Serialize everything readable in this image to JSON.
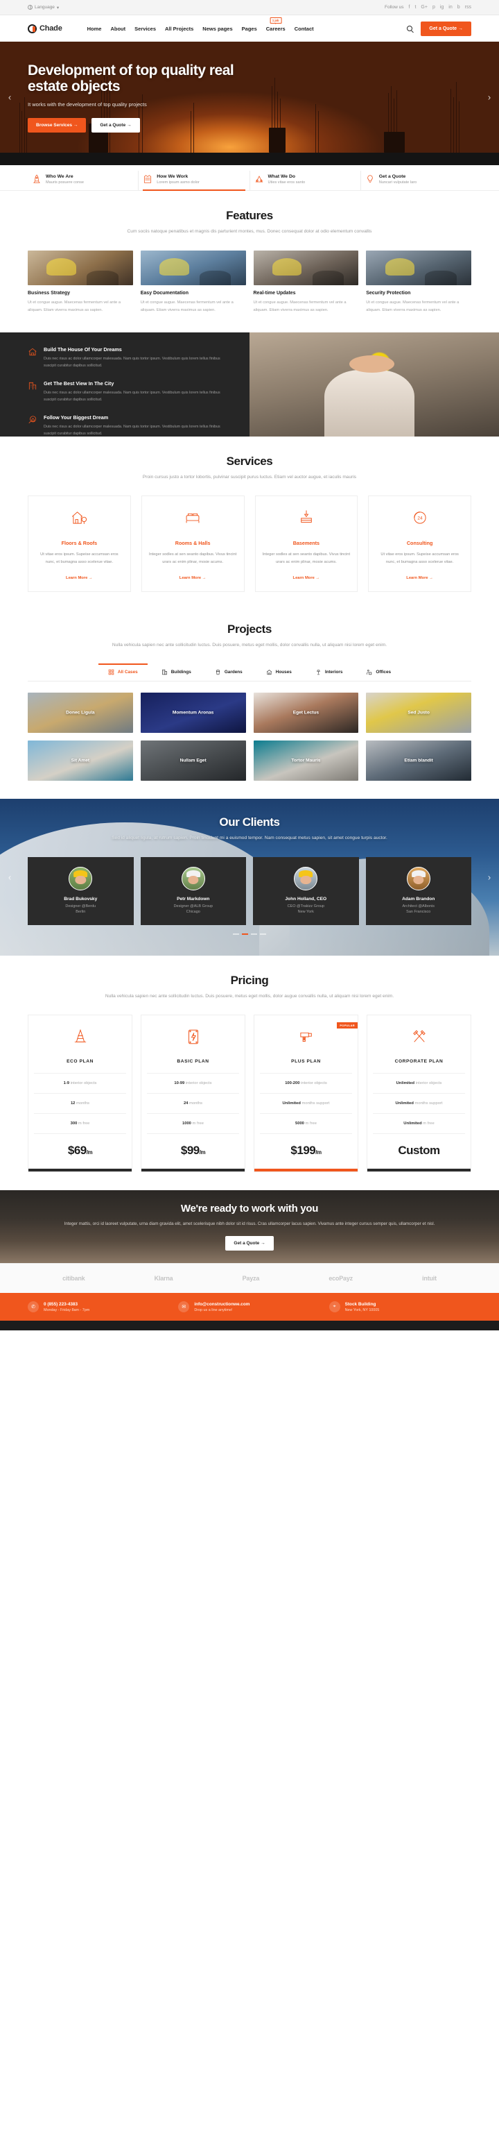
{
  "topbar": {
    "language_label": "Language",
    "language_caret": "▾",
    "follow_label": "Follow us",
    "socials": [
      "f",
      "t",
      "G+",
      "p",
      "ig",
      "in",
      "b",
      "rss"
    ]
  },
  "header": {
    "logo_text": "Chade",
    "nav": [
      {
        "label": "Home"
      },
      {
        "label": "About"
      },
      {
        "label": "Services"
      },
      {
        "label": "All Projects"
      },
      {
        "label": "News pages"
      },
      {
        "label": "Pages"
      },
      {
        "label": "Careers",
        "badge": "1 job"
      },
      {
        "label": "Contact"
      }
    ],
    "quote_button": "Get a Quote  →"
  },
  "hero": {
    "title": "Development of top quality real estate objects",
    "subtitle": "It works with the development of top quality projects",
    "btn_primary": "Browse Services  →",
    "btn_secondary": "Get a Quote  →",
    "prev": "‹",
    "next": "›"
  },
  "quickbar": [
    {
      "title": "Who We Are",
      "sub": "Mauris posuere conse",
      "icon": "rocket-icon"
    },
    {
      "title": "How We Work",
      "sub": "Lorem ipsum asmo dolor",
      "icon": "vest-icon"
    },
    {
      "title": "What We Do",
      "sub": "Uties vitae eros santo",
      "icon": "crane-icon"
    },
    {
      "title": "Get a Quote",
      "sub": "Nuncari vulputate laro",
      "icon": "bulb-icon"
    }
  ],
  "features": {
    "title": "Features",
    "subtitle": "Cum sociis natoque penatibus et magnis dis parturient montes, mus. Donec consequat dolor at odio elementum convallis",
    "items": [
      {
        "title": "Business Strategy",
        "desc": "Ut et congue augue. Maecenas fermentum vel ante a aliquam. Etiam viverra maximus as sapien."
      },
      {
        "title": "Easy Documentation",
        "desc": "Ut et congue augue. Maecenas fermentum vel ante a aliquam. Etiam viverra maximus as sapien."
      },
      {
        "title": "Real-time Updates",
        "desc": "Ut et congue augue. Maecenas fermentum vel ante a aliquam. Etiam viverra maximus as sapien."
      },
      {
        "title": "Security Protection",
        "desc": "Ut et congue augue. Maecenas fermentum vel ante a aliquam. Etiam viverra maximus as sapien."
      }
    ]
  },
  "split": {
    "items": [
      {
        "title": "Build The House Of Your Dreams",
        "desc": "Duis nec risus ac dolor ullamcorper malesuada. Nam quis tortor ipsum. Vestibulum quis lorem tellus finibus suscipit curabitur dapibus sollicitud.",
        "icon": "house-icon"
      },
      {
        "title": "Get The Best View In The City",
        "desc": "Duis nec risus ac dolor ullamcorper malesuada. Nam quis tortor ipsum. Vestibulum quis lorem tellus finibus suscipit curabitur dapibus sollicitud.",
        "icon": "building-icon"
      },
      {
        "title": "Follow Your Biggest Dream",
        "desc": "Duis nec risus ac dolor ullamcorper malesuada. Nam quis tortor ipsum. Vestibulum quis lorem tellus finibus suscipit curabitur dapibus sollicitud.",
        "icon": "search-house-icon"
      }
    ]
  },
  "services": {
    "title": "Services",
    "subtitle": "Proin cursus justo a tortor lobortis, pulvinar suscipit purus luctus. Etiam vel auctor augue, et iaculis mauris",
    "cards": [
      {
        "title": "Floors & Roofs",
        "desc": "Ut vitae eros ipsum. Supeise accumsan eros nunc, et bumagna asso scelerue vitae.",
        "more": "Learn More  →",
        "icon": "house-tree-icon"
      },
      {
        "title": "Rooms & Halls",
        "desc": "Integer sodles at sen seanto dapibus. Vivus tincint urars ac enim plinar, mosie acums.",
        "more": "Learn More  →",
        "icon": "bed-icon"
      },
      {
        "title": "Basements",
        "desc": "Integer sodles at sen seanto dapibus. Vivus tincint urars ac enim plinar, mosie acums.",
        "more": "Learn More  →",
        "icon": "crane-hook-icon"
      },
      {
        "title": "Consulting",
        "desc": "Ut vitae eros ipsum. Supeise accumsan eros nunc, et bumagna asso scelerue vitae.",
        "more": "Learn More  →",
        "icon": "24-support-icon"
      }
    ]
  },
  "projects": {
    "title": "Projects",
    "subtitle": "Nulla vehicula sapien nec ante sollicitudin luctus. Duis posuere, metus eget mollis, dolor convallis nulla, ut aliquam nisi lorem eget enim.",
    "filters": [
      {
        "label": "All Cases",
        "icon": "grid-icon",
        "active": true
      },
      {
        "label": "Buildings",
        "icon": "buildings-icon",
        "active": false
      },
      {
        "label": "Gardens",
        "icon": "plant-icon",
        "active": false
      },
      {
        "label": "Houses",
        "icon": "house-icon",
        "active": false
      },
      {
        "label": "Interiors",
        "icon": "lamp-icon",
        "active": false
      },
      {
        "label": "Offices",
        "icon": "desk-icon",
        "active": false
      }
    ],
    "cards": [
      {
        "label": "Donec Ligula"
      },
      {
        "label": "Momentum Aronas"
      },
      {
        "label": "Eget Lectus"
      },
      {
        "label": "Sed Justo"
      },
      {
        "label": "Sit Amet"
      },
      {
        "label": "Nullam Eget"
      },
      {
        "label": "Tortor Mauris"
      },
      {
        "label": "Etiam blandit"
      }
    ]
  },
  "clients": {
    "title": "Our Clients",
    "subtitle": "Sed id aliquet ligula, at rutrum sapien. Proin tincidunt mi a euismod tempor. Nam consequat metus sapien, sit amet congue turpis auctor.",
    "prev": "‹",
    "next": "›",
    "cards": [
      {
        "name": "Brad Bukovsky",
        "role": "Designer @Berdu",
        "city": "Berlin"
      },
      {
        "name": "Petr Markdown",
        "role": "Designer @ALB Group",
        "city": "Chicago"
      },
      {
        "name": "John Holland, CEO",
        "role": "CEO @Trakizz Group",
        "city": "New York"
      },
      {
        "name": "Adam Brandon",
        "role": "Architect @Albonis",
        "city": "San Francisco"
      }
    ]
  },
  "pricing": {
    "title": "Pricing",
    "subtitle": "Nulla vehicula sapien nec ante sollicitudin luctus. Duis posuere, metus eget mollis, dolor augue convallis nulla, ut aliquam nisi lorem eget enim.",
    "popular_badge": "POPULAR",
    "plans": [
      {
        "name": "ECO PLAN",
        "icon": "cone-icon",
        "rows": [
          {
            "strong": "1-9",
            "rest": " interior objects"
          },
          {
            "strong": "12",
            "rest": " months"
          },
          {
            "strong": "300",
            "rest": " m free"
          }
        ],
        "amount": "$69",
        "per": "/m",
        "accent": false
      },
      {
        "name": "BASIC PLAN",
        "icon": "battery-icon",
        "rows": [
          {
            "strong": "10-99",
            "rest": " interior objects"
          },
          {
            "strong": "24",
            "rest": " months"
          },
          {
            "strong": "1000",
            "rest": " m free"
          }
        ],
        "amount": "$99",
        "per": "/m",
        "accent": false
      },
      {
        "name": "PLUS PLAN",
        "icon": "drill-icon",
        "popular": true,
        "rows": [
          {
            "strong": "100-200",
            "rest": " interior objects"
          },
          {
            "strong": "Unlimited",
            "rest": " months support"
          },
          {
            "strong": "5000",
            "rest": " m free"
          }
        ],
        "amount": "$199",
        "per": "/m",
        "accent": true
      },
      {
        "name": "CORPORATE PLAN",
        "icon": "tools-icon",
        "rows": [
          {
            "strong": "Unlimited",
            "rest": " interior objects"
          },
          {
            "strong": "Unlimited",
            "rest": " months support"
          },
          {
            "strong": "Unlimited",
            "rest": " m free"
          }
        ],
        "amount": "Custom",
        "per": "",
        "accent": false
      }
    ]
  },
  "cta": {
    "title": "We're ready to work with you",
    "text": "Integer mattis, orci id laoreet vulputate, urna diam gravida elit, amet scelerisque nibh dolor sit id risus. Cras ullamcorper lacus sapien. Vivamus ante integer cursus semper quis, ullamcorper et nisl.",
    "button": "Get a Quote  →"
  },
  "brands": [
    "citibank",
    "Klarna",
    "Payza",
    "ecoPayz",
    "intuit"
  ],
  "footer_contact": [
    {
      "title": "0 (855) 223-4383",
      "sub": "Monday - Friday 8am - 7pm",
      "icon": "phone-icon"
    },
    {
      "title": "info@constructionwe.com",
      "sub": "Drop us a line anytime!",
      "icon": "mail-icon"
    },
    {
      "title": "Stock Building",
      "sub": "New York, NY 10005",
      "icon": "pin-icon"
    }
  ]
}
